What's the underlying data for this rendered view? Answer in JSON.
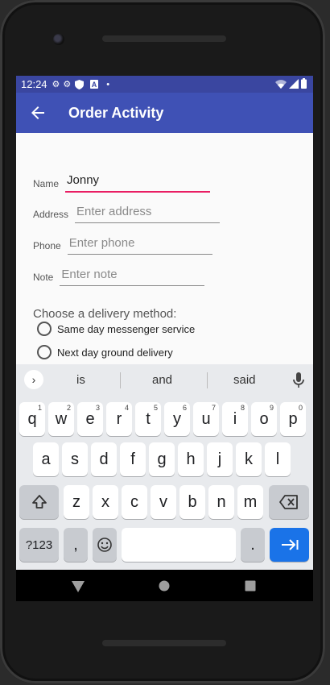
{
  "status": {
    "time": "12:24",
    "icons": [
      "gear-icon",
      "gear-icon",
      "shield-icon",
      "a-icon",
      "dot-icon"
    ]
  },
  "appbar": {
    "title": "Order Activity"
  },
  "form": {
    "name": {
      "label": "Name",
      "value": "Jonny",
      "placeholder": ""
    },
    "address": {
      "label": "Address",
      "value": "",
      "placeholder": "Enter address"
    },
    "phone": {
      "label": "Phone",
      "value": "",
      "placeholder": "Enter phone"
    },
    "note": {
      "label": "Note",
      "value": "",
      "placeholder": "Enter note"
    }
  },
  "delivery": {
    "prompt": "Choose a delivery method:",
    "options": [
      "Same day messenger service",
      "Next day ground delivery"
    ]
  },
  "keyboard": {
    "suggestions": [
      "is",
      "and",
      "said"
    ],
    "row1": [
      "q",
      "w",
      "e",
      "r",
      "t",
      "y",
      "u",
      "i",
      "o",
      "p"
    ],
    "row1_hints": [
      "1",
      "2",
      "3",
      "4",
      "5",
      "6",
      "7",
      "8",
      "9",
      "0"
    ],
    "row2": [
      "a",
      "s",
      "d",
      "f",
      "g",
      "h",
      "j",
      "k",
      "l"
    ],
    "row3": [
      "z",
      "x",
      "c",
      "v",
      "b",
      "n",
      "m"
    ],
    "symbols_key": "?123",
    "comma_key": ",",
    "period_key": "."
  },
  "colors": {
    "appbar": "#3f51b5",
    "statusbar": "#3a46a0",
    "accent": "#e91e63",
    "enter_key": "#1a73e8"
  }
}
